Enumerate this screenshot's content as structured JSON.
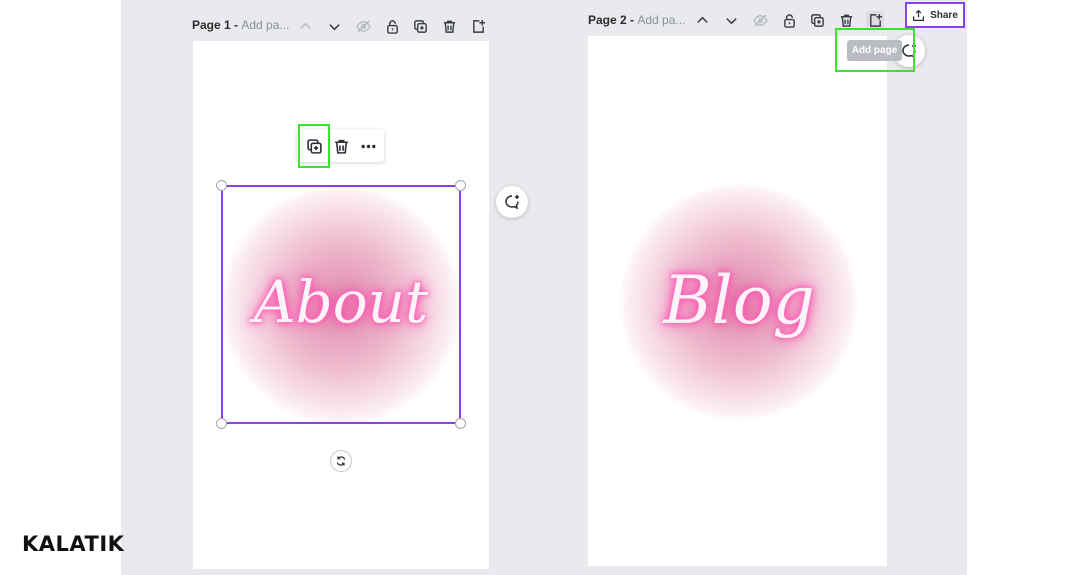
{
  "pages": [
    {
      "title": "Page 1",
      "separator": " - ",
      "subtitle": "Add pa...",
      "artwork_text": "About",
      "icons": [
        "chevron-up-icon",
        "chevron-down-icon",
        "eye-hide-icon",
        "lock-icon",
        "duplicate-icon",
        "trash-icon",
        "add-page-icon"
      ]
    },
    {
      "title": "Page 2",
      "separator": " - ",
      "subtitle": "Add pa...",
      "artwork_text": "Blog",
      "icons": [
        "chevron-up-icon",
        "chevron-down-icon",
        "eye-hide-icon",
        "lock-icon",
        "duplicate-icon",
        "trash-icon",
        "add-page-icon"
      ]
    }
  ],
  "selection_toolbar": {
    "icons": [
      "duplicate-icon",
      "trash-icon",
      "more-options-icon"
    ]
  },
  "tooltip": {
    "text": "Add page"
  },
  "share": {
    "label": "Share"
  },
  "watermark": {
    "text": "KALATIK"
  },
  "colors": {
    "highlight_green": "#39e52a",
    "selection_purple": "#8a3ff0",
    "workspace_bg": "#e9eaee",
    "neon_pink": "#ff4fb3"
  }
}
